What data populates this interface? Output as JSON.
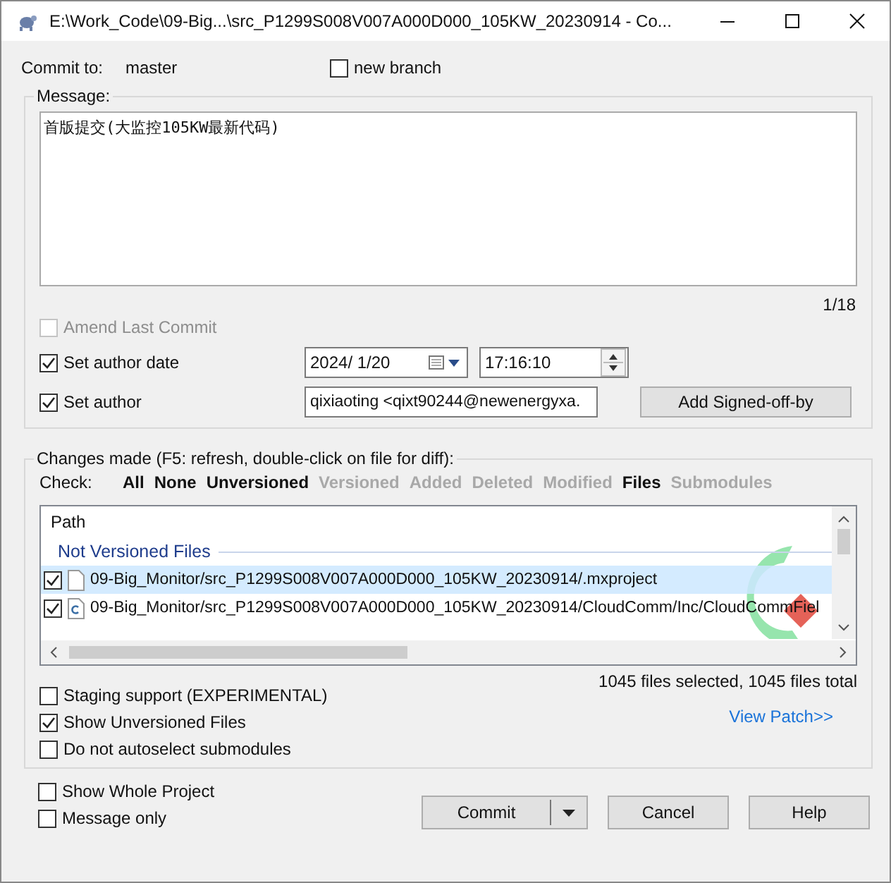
{
  "window": {
    "title": "E:\\Work_Code\\09-Big...\\src_P1299S008V007A000D000_105KW_20230914 - Co..."
  },
  "commit_to": {
    "label": "Commit to:",
    "branch": "master",
    "new_branch": {
      "label": "new branch",
      "checked": false
    }
  },
  "message": {
    "label": "Message:",
    "text": "首版提交(大监控105KW最新代码)",
    "counter": "1/18"
  },
  "amend": {
    "label": "Amend Last Commit",
    "checked": false,
    "disabled": true
  },
  "author_date": {
    "label": "Set author date",
    "checked": true,
    "date": "2024/  1/20",
    "time": "17:16:10"
  },
  "author": {
    "label": "Set author",
    "checked": true,
    "value": "qixiaoting <qixt90244@newenergyxa."
  },
  "signoff_button": "Add Signed-off-by",
  "changes": {
    "label": "Changes made (F5: refresh, double-click on file for diff):",
    "check_label": "Check:",
    "filters": [
      {
        "label": "All",
        "disabled": false
      },
      {
        "label": "None",
        "disabled": false
      },
      {
        "label": "Unversioned",
        "disabled": false
      },
      {
        "label": "Versioned",
        "disabled": true
      },
      {
        "label": "Added",
        "disabled": true
      },
      {
        "label": "Deleted",
        "disabled": true
      },
      {
        "label": "Modified",
        "disabled": true
      },
      {
        "label": "Files",
        "disabled": false
      },
      {
        "label": "Submodules",
        "disabled": true
      }
    ],
    "list": {
      "header": "Path",
      "group": "Not Versioned Files",
      "rows": [
        {
          "path": "09-Big_Monitor/src_P1299S008V007A000D000_105KW_20230914/.mxproject",
          "checked": true,
          "selected": true,
          "kind": "file"
        },
        {
          "path": "09-Big_Monitor/src_P1299S008V007A000D000_105KW_20230914/CloudComm/Inc/CloudCommFiel",
          "checked": true,
          "selected": false,
          "kind": "c-source"
        }
      ]
    },
    "summary": "1045 files selected, 1045 files total",
    "settings": [
      {
        "label": "Staging support (EXPERIMENTAL)",
        "checked": false
      },
      {
        "label": "Show Unversioned Files",
        "checked": true
      },
      {
        "label": "Do not autoselect submodules",
        "checked": false
      }
    ],
    "view_patch": "View Patch>>"
  },
  "bottom_options": [
    {
      "label": "Show Whole Project",
      "checked": false
    },
    {
      "label": "Message only",
      "checked": false
    }
  ],
  "buttons": [
    {
      "label": "Commit",
      "kind": "split"
    },
    {
      "label": "Cancel",
      "kind": "plain"
    },
    {
      "label": "Help",
      "kind": "plain"
    }
  ]
}
